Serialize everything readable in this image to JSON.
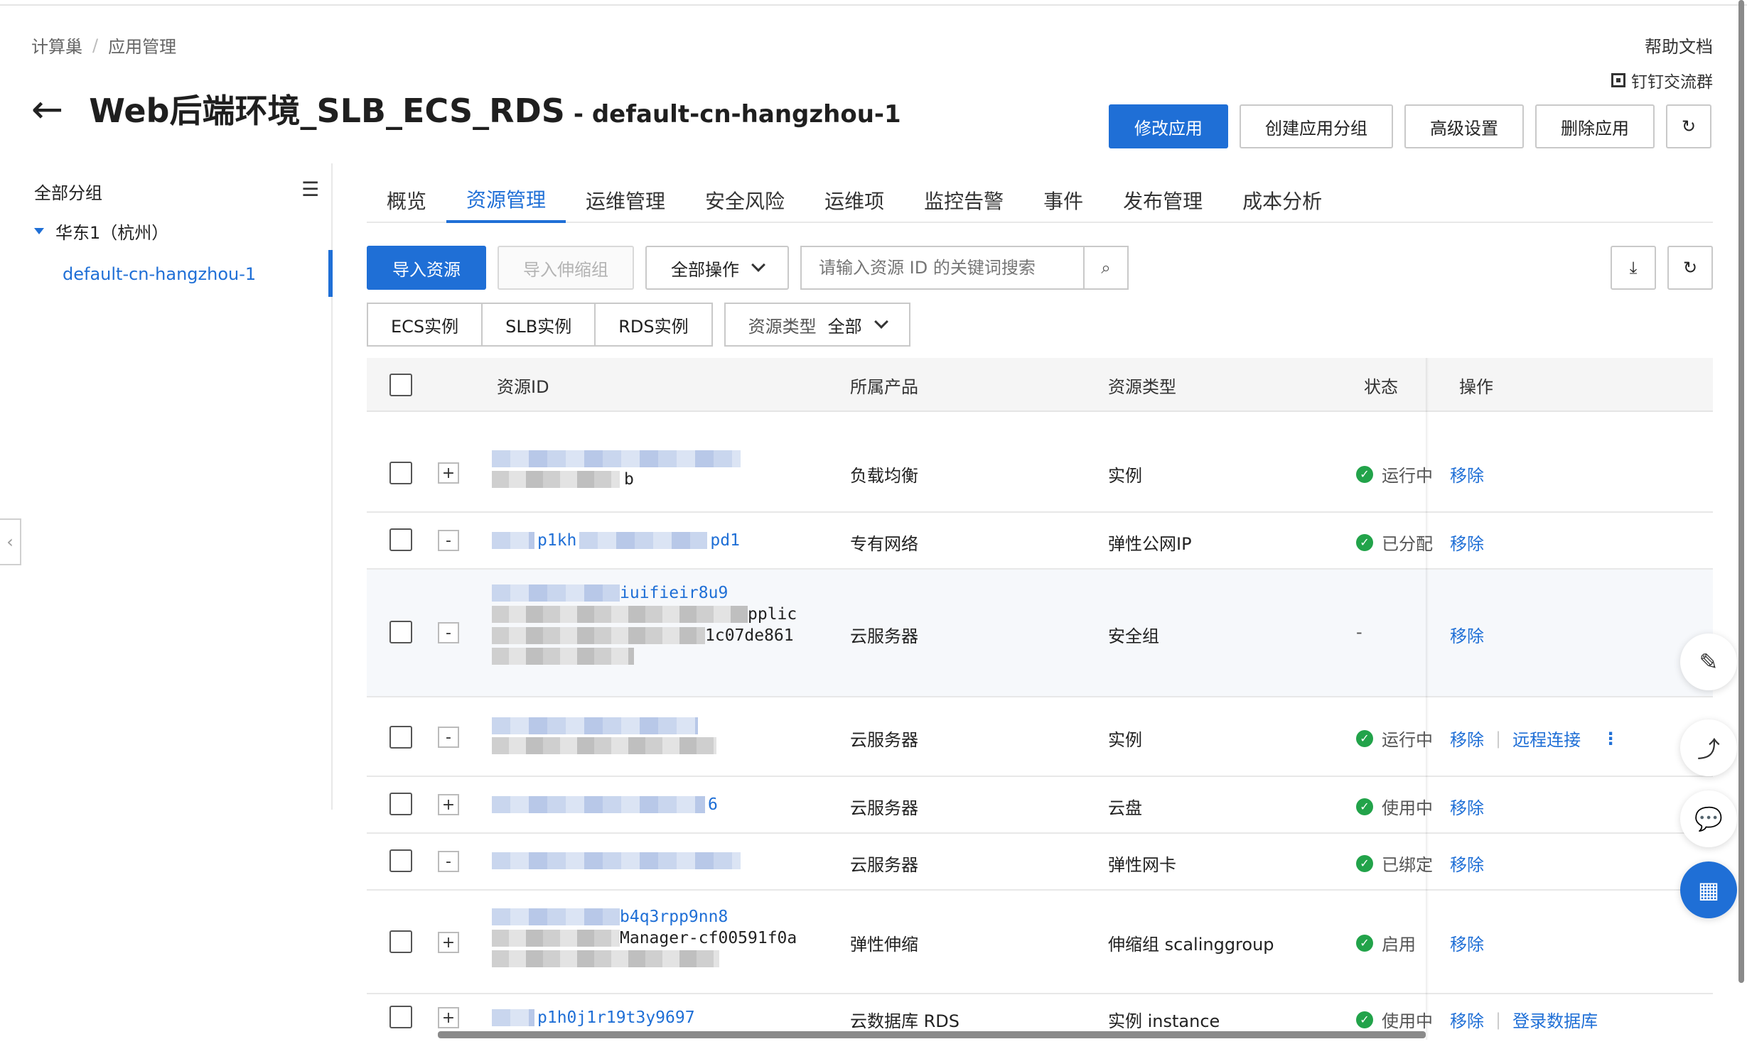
{
  "breadcrumb": {
    "root": "计算巢",
    "current": "应用管理"
  },
  "header": {
    "help": "帮助文档",
    "dingtalk": "钉钉交流群",
    "title": "Web后端环境_SLB_ECS_RDS",
    "subtitle": "- default-cn-hangzhou-1",
    "actions": {
      "modify": "修改应用",
      "create_group": "创建应用分组",
      "advanced": "高级设置",
      "delete": "删除应用"
    }
  },
  "sidebar": {
    "title": "全部分组",
    "group": "华东1（杭州）",
    "node": "default-cn-hangzhou-1"
  },
  "tabs": [
    "概览",
    "资源管理",
    "运维管理",
    "安全风险",
    "运维项",
    "监控告警",
    "事件",
    "发布管理",
    "成本分析"
  ],
  "toolbar": {
    "import": "导入资源",
    "import_scaling": "导入伸缩组",
    "all_ops": "全部操作",
    "search_placeholder": "请输入资源 ID 的关键词搜索"
  },
  "filters": {
    "ecs": "ECS实例",
    "slb": "SLB实例",
    "rds": "RDS实例",
    "type_label": "资源类型",
    "type_value": "全部"
  },
  "table": {
    "headers": {
      "id": "资源ID",
      "product": "所属产品",
      "type": "资源类型",
      "status": "状态",
      "ops": "操作"
    },
    "rows": [
      {
        "id_tail": "b",
        "product": "负载均衡",
        "type": "实例",
        "status": "运行中",
        "ops": [
          "移除"
        ]
      },
      {
        "id_tail": "p1kh",
        "id_tail2": "pd1",
        "product": "专有网络",
        "type": "弹性公网IP",
        "status": "已分配",
        "ops": [
          "移除"
        ]
      },
      {
        "id_tail": "iuifieir8u9",
        "id_tail2": "pplic",
        "id_tail3": "1c07de861",
        "product": "云服务器",
        "type": "安全组",
        "status": "-",
        "ops": [
          "移除"
        ]
      },
      {
        "id_tail": "",
        "product": "云服务器",
        "type": "实例",
        "status": "运行中",
        "ops": [
          "移除",
          "远程连接"
        ]
      },
      {
        "id_tail": "6",
        "product": "云服务器",
        "type": "云盘",
        "status": "使用中",
        "ops": [
          "移除"
        ]
      },
      {
        "id_tail": "",
        "product": "云服务器",
        "type": "弹性网卡",
        "status": "已绑定",
        "ops": [
          "移除"
        ]
      },
      {
        "id_tail": "b4q3rpp9nn8",
        "id_tail2": "Manager-cf00591f0a",
        "product": "弹性伸缩",
        "type": "伸缩组 scalinggroup",
        "status": "启用",
        "ops": [
          "移除"
        ]
      },
      {
        "id_tail": "p1h0j1r19t3y9697",
        "product": "云数据库 RDS",
        "type": "实例 instance",
        "status": "使用中",
        "ops": [
          "移除",
          "登录数据库"
        ]
      }
    ]
  },
  "colors": {
    "primary": "#1f6fd6",
    "ok": "#22a34a"
  }
}
